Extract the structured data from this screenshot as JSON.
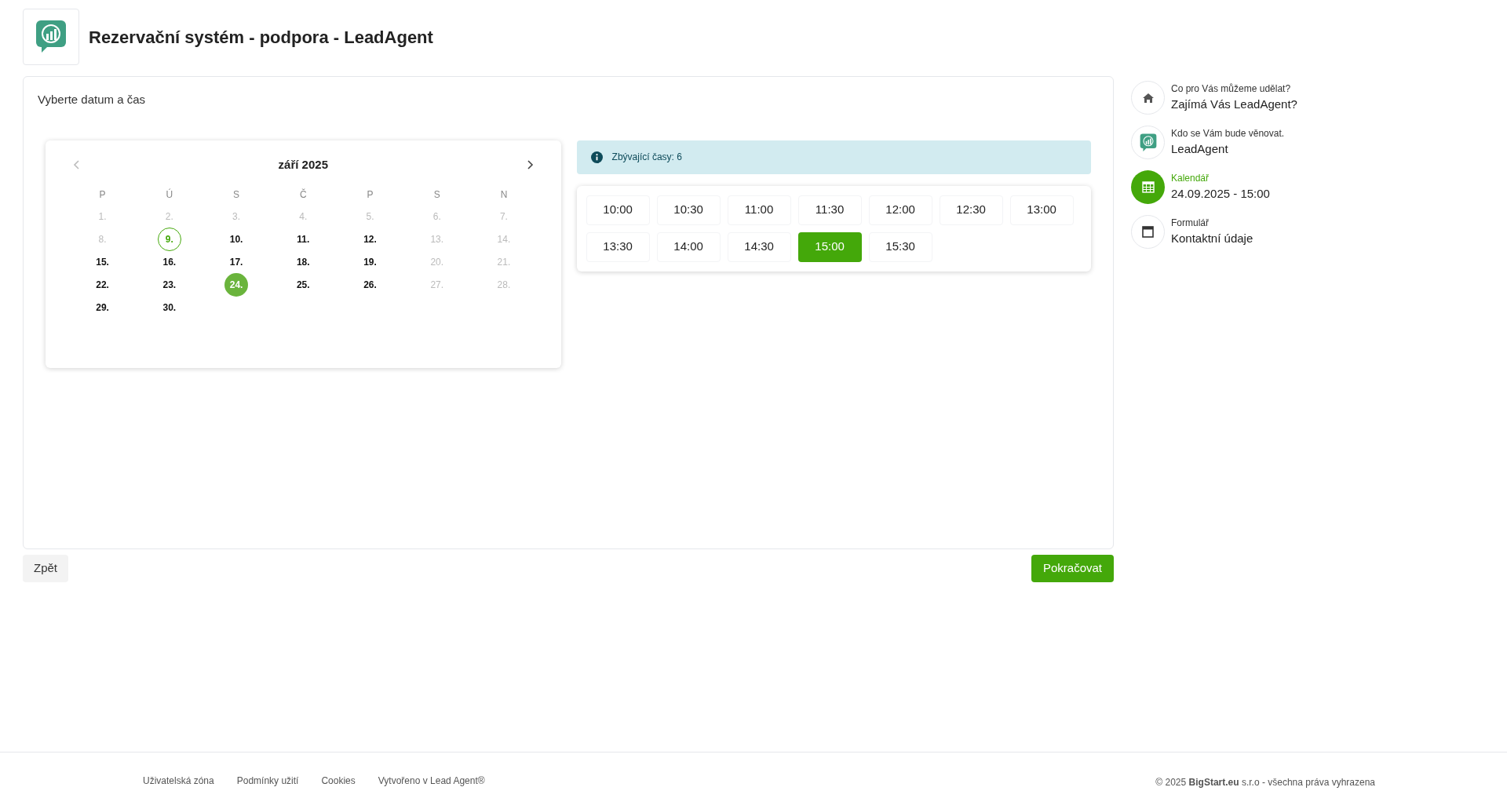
{
  "header": {
    "title": "Rezervační systém - podpora - LeadAgent"
  },
  "main": {
    "heading": "Vyberte datum a čas",
    "calendar": {
      "month": "září 2025",
      "weekdays": [
        "P",
        "Ú",
        "S",
        "Č",
        "P",
        "S",
        "N"
      ],
      "days": [
        {
          "label": "1.",
          "disabled": true,
          "today": false,
          "selected": false
        },
        {
          "label": "2.",
          "disabled": true,
          "today": false,
          "selected": false
        },
        {
          "label": "3.",
          "disabled": true,
          "today": false,
          "selected": false
        },
        {
          "label": "4.",
          "disabled": true,
          "today": false,
          "selected": false
        },
        {
          "label": "5.",
          "disabled": true,
          "today": false,
          "selected": false
        },
        {
          "label": "6.",
          "disabled": true,
          "today": false,
          "selected": false
        },
        {
          "label": "7.",
          "disabled": true,
          "today": false,
          "selected": false
        },
        {
          "label": "8.",
          "disabled": true,
          "today": false,
          "selected": false
        },
        {
          "label": "9.",
          "disabled": false,
          "today": true,
          "selected": false
        },
        {
          "label": "10.",
          "disabled": false,
          "today": false,
          "selected": false
        },
        {
          "label": "11.",
          "disabled": false,
          "today": false,
          "selected": false
        },
        {
          "label": "12.",
          "disabled": false,
          "today": false,
          "selected": false
        },
        {
          "label": "13.",
          "disabled": true,
          "today": false,
          "selected": false
        },
        {
          "label": "14.",
          "disabled": true,
          "today": false,
          "selected": false
        },
        {
          "label": "15.",
          "disabled": false,
          "today": false,
          "selected": false
        },
        {
          "label": "16.",
          "disabled": false,
          "today": false,
          "selected": false
        },
        {
          "label": "17.",
          "disabled": false,
          "today": false,
          "selected": false
        },
        {
          "label": "18.",
          "disabled": false,
          "today": false,
          "selected": false
        },
        {
          "label": "19.",
          "disabled": false,
          "today": false,
          "selected": false
        },
        {
          "label": "20.",
          "disabled": true,
          "today": false,
          "selected": false
        },
        {
          "label": "21.",
          "disabled": true,
          "today": false,
          "selected": false
        },
        {
          "label": "22.",
          "disabled": false,
          "today": false,
          "selected": false
        },
        {
          "label": "23.",
          "disabled": false,
          "today": false,
          "selected": false
        },
        {
          "label": "24.",
          "disabled": false,
          "today": false,
          "selected": true
        },
        {
          "label": "25.",
          "disabled": false,
          "today": false,
          "selected": false
        },
        {
          "label": "26.",
          "disabled": false,
          "today": false,
          "selected": false
        },
        {
          "label": "27.",
          "disabled": true,
          "today": false,
          "selected": false
        },
        {
          "label": "28.",
          "disabled": true,
          "today": false,
          "selected": false
        },
        {
          "label": "29.",
          "disabled": false,
          "today": false,
          "selected": false
        },
        {
          "label": "30.",
          "disabled": false,
          "today": false,
          "selected": false
        }
      ]
    },
    "remaining": "Zbývající časy: 6",
    "slots": [
      {
        "label": "10:00",
        "selected": false
      },
      {
        "label": "10:30",
        "selected": false
      },
      {
        "label": "11:00",
        "selected": false
      },
      {
        "label": "11:30",
        "selected": false
      },
      {
        "label": "12:00",
        "selected": false
      },
      {
        "label": "12:30",
        "selected": false
      },
      {
        "label": "13:00",
        "selected": false
      },
      {
        "label": "13:30",
        "selected": false
      },
      {
        "label": "14:00",
        "selected": false
      },
      {
        "label": "14:30",
        "selected": false
      },
      {
        "label": "15:00",
        "selected": true
      },
      {
        "label": "15:30",
        "selected": false
      }
    ]
  },
  "buttons": {
    "back": "Zpět",
    "next": "Pokračovat"
  },
  "steps": [
    {
      "kind": "home",
      "caption": "Co pro Vás můžeme udělat?",
      "value": "Zajímá Vás LeadAgent?",
      "active": false
    },
    {
      "kind": "logo",
      "caption": "Kdo se Vám bude věnovat.",
      "value": "LeadAgent",
      "active": false
    },
    {
      "kind": "calendar",
      "caption": "Kalendář",
      "value": "24.09.2025 - 15:00",
      "active": true
    },
    {
      "kind": "form",
      "caption": "Formulář",
      "value": "Kontaktní údaje",
      "active": false
    }
  ],
  "footer": {
    "links": [
      "Uživatelská zóna",
      "Podmínky užití",
      "Cookies",
      "Vytvořeno v Lead Agent®"
    ],
    "copyright": "© 2025 **BigStart.eu** s.r.o - všechna práva vyhrazena"
  }
}
